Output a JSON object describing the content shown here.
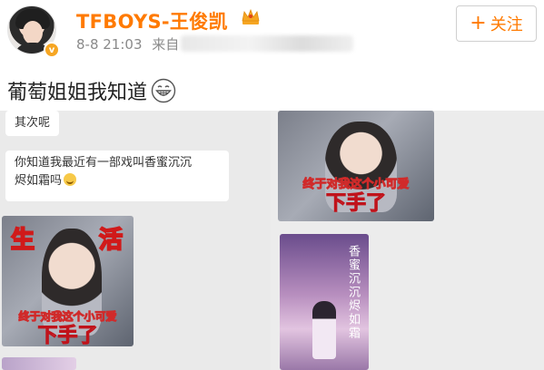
{
  "user": {
    "name": "TFBOYS-王俊凯",
    "verified_badge": "v",
    "timestamp": "8-8 21:03",
    "source_prefix": "来自"
  },
  "follow_button": {
    "plus": "+",
    "label": "关注"
  },
  "post": {
    "text": "葡萄姐姐我知道"
  },
  "chat": {
    "messages": [
      {
        "text": "其次呢"
      },
      {
        "line1": "你知道我最近有一部戏叫香蜜沉沉",
        "line2": "烬如霜吗"
      }
    ]
  },
  "stills": {
    "left_title_1": "生",
    "left_title_2": "活",
    "caption_small": "终于对我这个小可爱",
    "caption_big": "下手了",
    "right_caption_small": "终于对我这个小可爱",
    "right_caption_big": "下手了"
  },
  "poster": {
    "title": "香蜜沉沉烬如霜"
  },
  "colors": {
    "name": "#ff7a00",
    "follow_text": "#ff7a00",
    "badge": "#f6a623",
    "caption_stroke": "#d01a1a"
  },
  "icons": [
    "avatar",
    "verified-badge-icon",
    "crown-icon",
    "grin-emoji-icon",
    "smile-emoji-icon",
    "plus-icon"
  ]
}
